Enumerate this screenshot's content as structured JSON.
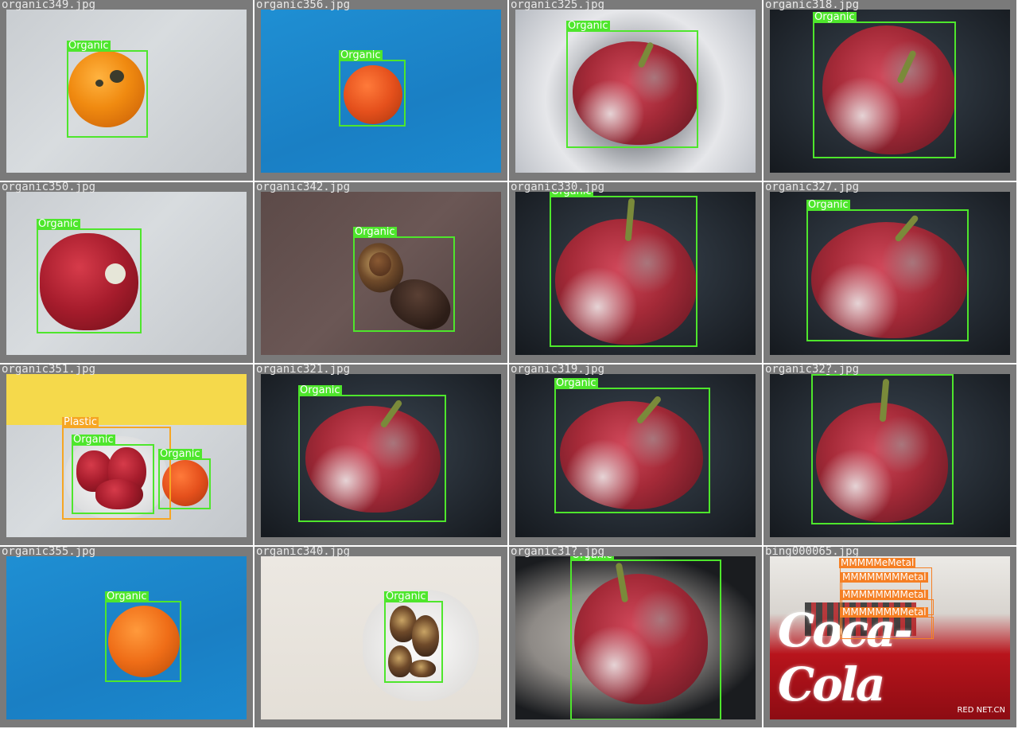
{
  "tiles": [
    {
      "file": "organic349.jpg"
    },
    {
      "file": "organic356.jpg"
    },
    {
      "file": "organic325.jpg"
    },
    {
      "file": "organic318.jpg"
    },
    {
      "file": "organic350.jpg"
    },
    {
      "file": "organic342.jpg"
    },
    {
      "file": "organic330.jpg"
    },
    {
      "file": "organic327.jpg"
    },
    {
      "file": "organic351.jpg"
    },
    {
      "file": "organic321.jpg"
    },
    {
      "file": "organic319.jpg"
    },
    {
      "file": "organic32?.jpg"
    },
    {
      "file": "organic355.jpg"
    },
    {
      "file": "organic340.jpg"
    },
    {
      "file": "organic31?.jpg"
    },
    {
      "file": "bing000065.jpg"
    }
  ],
  "labels": {
    "organic": "Organic",
    "plastic": "Plastic",
    "metal": "Metal",
    "metal_stack": "MMMMMeMetal",
    "metal_row": "MMMMMMMMetal"
  },
  "brand": {
    "logo_text": "Coca-Cola",
    "watermark": "RED NET.CN"
  },
  "colors": {
    "organic_box": "#4ee62c",
    "plastic_box": "#f6a623",
    "metal_box": "#f57f24",
    "tile_frame": "#7a7a7a"
  }
}
